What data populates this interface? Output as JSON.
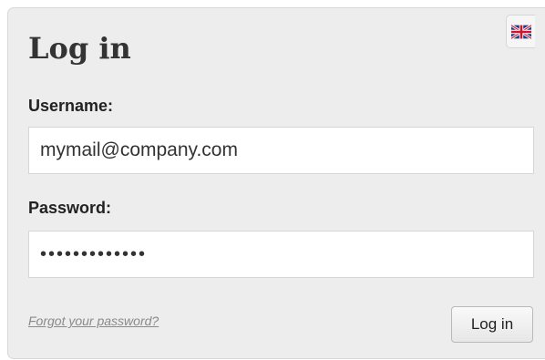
{
  "form": {
    "title": "Log in",
    "username_label": "Username:",
    "username_value": "mymail@company.com",
    "password_label": "Password:",
    "password_value": "•••••••••••••",
    "forgot_link": "Forgot your password?",
    "login_button": "Log in"
  },
  "language": {
    "icon": "uk-flag-icon"
  },
  "colors": {
    "panel_bg": "#ededed",
    "title": "#333333",
    "link": "#8a8a8a"
  }
}
